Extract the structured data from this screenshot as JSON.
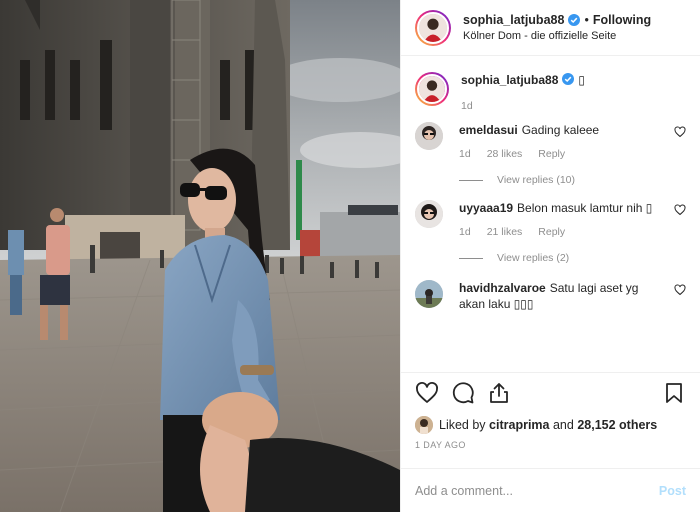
{
  "post": {
    "author": {
      "username": "sophia_latjuba88",
      "verified": true,
      "follow_status": "Following",
      "location": "Kölner Dom - die offizielle Seite"
    },
    "caption": {
      "username": "sophia_latjuba88",
      "text": "▯",
      "age": "1d"
    },
    "comments": [
      {
        "username": "emeldasui",
        "text": "Gading kaleee",
        "age": "1d",
        "likes": "28 likes",
        "reply_label": "Reply",
        "view_replies": "View replies (10)"
      },
      {
        "username": "uyyaaa19",
        "text": "Belon masuk lamtur nih ▯",
        "age": "1d",
        "likes": "21 likes",
        "reply_label": "Reply",
        "view_replies": "View replies (2)"
      },
      {
        "username": "havidhzalvaroe",
        "text": "Satu lagi aset yg akan laku ▯▯▯"
      }
    ],
    "liked_by": {
      "prefix": "Liked by",
      "user": "citraprima",
      "joiner": "and",
      "others": "28,152 others"
    },
    "timestamp": "1 DAY AGO",
    "add_comment": {
      "placeholder": "Add a comment...",
      "post_label": "Post"
    },
    "icons": {
      "like": "heart-icon",
      "comment": "comment-icon",
      "share": "share-icon",
      "save": "bookmark-icon",
      "verified": "verified-badge-icon"
    },
    "colors": {
      "text": "#262626",
      "muted": "#8e8e8e",
      "verified": "#3897f0",
      "post_disabled": "#b2dffc",
      "border": "#efefef"
    }
  }
}
